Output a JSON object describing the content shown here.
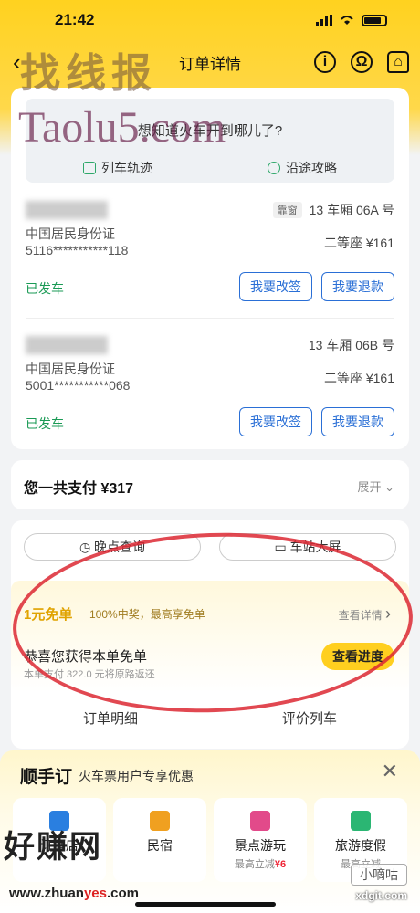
{
  "status_bar": {
    "time": "21:42"
  },
  "nav": {
    "title": "订单详情",
    "back": "‹",
    "icon_info": "i",
    "icon_service": "Ω",
    "icon_home": "⌂"
  },
  "watermarks": {
    "top_cn": "找线报",
    "top_en": "Taolu5.com",
    "bottom_cn": "好赚网",
    "bottom_url_a": "www.zhuan",
    "bottom_url_b": "yes",
    "bottom_url_c": ".com",
    "bottom_right_cn": "小嘀咕",
    "bottom_right_en": "xdgit.com"
  },
  "map": {
    "question": "想知道火车开到哪儿了?",
    "track_label": "列车轨迹",
    "guide_label": "沿途攻略"
  },
  "passengers": [
    {
      "seat_tag": "靠窗",
      "seat": "13 车厢 06A 号",
      "id_type": "中国居民身份证",
      "id_number": "5116***********118",
      "class_price": "二等座 ¥161",
      "status": "已发车",
      "change_label": "我要改签",
      "refund_label": "我要退款"
    },
    {
      "seat_tag": "",
      "seat": "13 车厢 06B 号",
      "id_type": "中国居民身份证",
      "id_number": "5001***********068",
      "class_price": "二等座 ¥161",
      "status": "已发车",
      "change_label": "我要改签",
      "refund_label": "我要退款"
    }
  ],
  "payment": {
    "label": "您一共支付 ¥317",
    "expand": "展开"
  },
  "tools": {
    "delay_label": "晚点查询",
    "screen_label": "车站大屏"
  },
  "promo": {
    "title": "1元免单",
    "subtitle": "100%中奖，最高享免单",
    "detail_link": "查看详情",
    "main_text": "恭喜您获得本单免单",
    "note": "本单支付 322.0 元将原路返还",
    "progress_button": "查看进度"
  },
  "order_tabs": {
    "detail": "订单明细",
    "review": "评价列车"
  },
  "shunshou": {
    "title": "顺手订",
    "subtitle": "火车票用户专享优惠",
    "close": "✕",
    "items": [
      {
        "name": "订酒店",
        "promo_prefix": "",
        "promo_value": "",
        "icon": "hotel-icon",
        "color": "#2a7fe0"
      },
      {
        "name": "民宿",
        "promo_prefix": "",
        "promo_value": "",
        "icon": "house-icon",
        "color": "#f0a020"
      },
      {
        "name": "景点游玩",
        "promo_prefix": "最高立减",
        "promo_value": "¥6",
        "icon": "castle-icon",
        "color": "#e24a8a"
      },
      {
        "name": "旅游度假",
        "promo_prefix": "最高立减",
        "promo_value": "",
        "icon": "beach-icon",
        "color": "#2bb673"
      }
    ]
  }
}
